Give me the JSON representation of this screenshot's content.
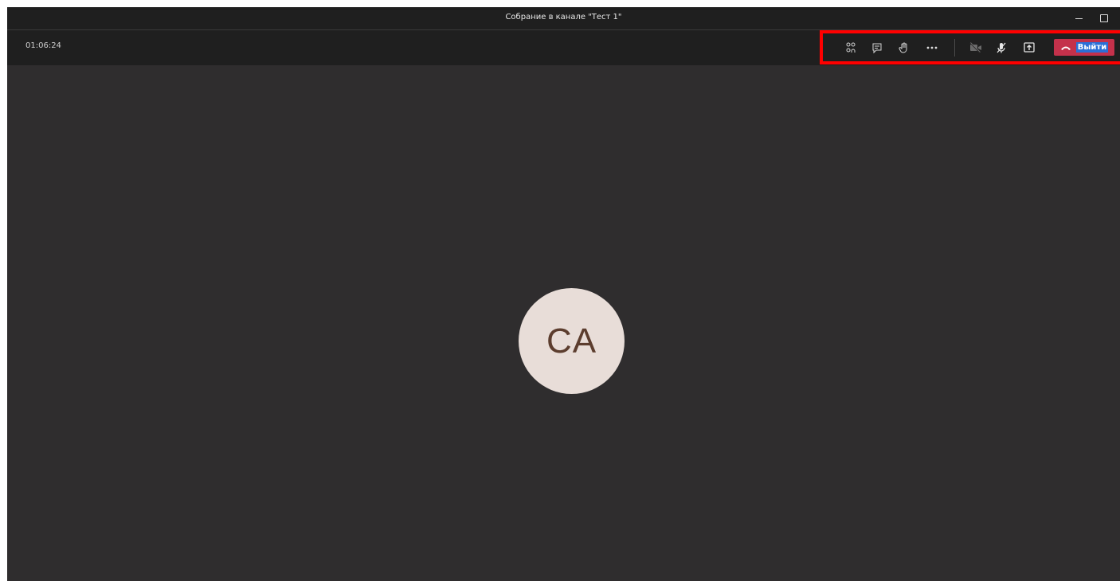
{
  "window": {
    "title": "Собрание в канале \"Тест 1\""
  },
  "call": {
    "timer": "01:06:24",
    "leave_label": "Выйти",
    "controls": [
      {
        "name": "participants",
        "icon": "people-icon"
      },
      {
        "name": "chat",
        "icon": "chat-icon"
      },
      {
        "name": "raise-hand",
        "icon": "hand-icon"
      },
      {
        "name": "more-actions",
        "icon": "more-icon"
      },
      {
        "name": "camera",
        "icon": "camera-off-icon"
      },
      {
        "name": "microphone",
        "icon": "mic-off-icon"
      },
      {
        "name": "share-screen",
        "icon": "share-tray-icon"
      },
      {
        "name": "leave",
        "icon": "hang-up-icon"
      }
    ]
  },
  "participant": {
    "initials": "CA"
  },
  "colors": {
    "stage_background": "#2f2d2e",
    "bar_background": "#1f1f1f",
    "leave_button": "#c4314b",
    "highlight_frame": "#ff0000",
    "avatar_background": "#e8ddd8",
    "avatar_text": "#5c3d2e"
  }
}
